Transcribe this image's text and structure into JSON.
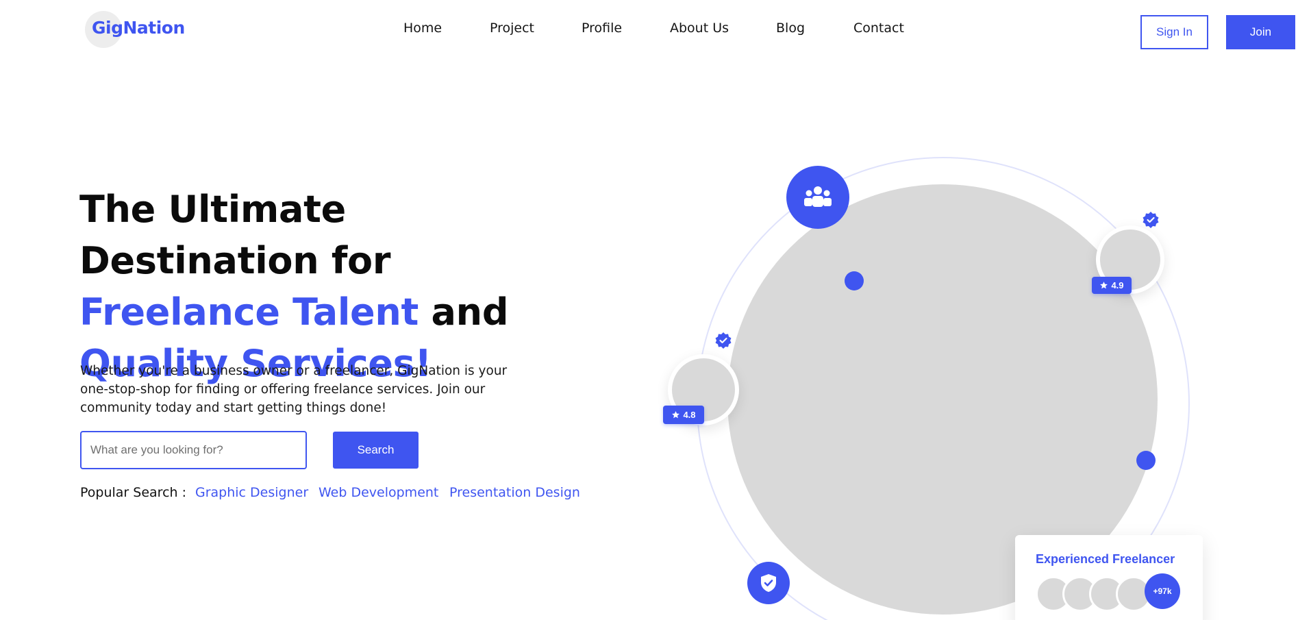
{
  "brand": {
    "logo_text": "GigNation",
    "accent_color": "#3f55f0"
  },
  "nav": {
    "items": [
      {
        "label": "Home"
      },
      {
        "label": "Project"
      },
      {
        "label": "Profile"
      },
      {
        "label": "About Us"
      },
      {
        "label": "Blog"
      },
      {
        "label": "Contact"
      }
    ]
  },
  "auth": {
    "sign_in_label": "Sign In",
    "join_label": "Join"
  },
  "hero": {
    "title_part1": "The Ultimate Destination for ",
    "title_accent1": "Freelance Talent",
    "title_part2": " and ",
    "title_accent2": "Quality Services!",
    "description": "Whether you're a business owner or a freelancer, GigNation is your one-stop-shop for finding or offering freelance services. Join our community today and start getting things done!"
  },
  "search": {
    "placeholder": "What are you looking for?",
    "value": "",
    "button_label": "Search"
  },
  "popular_search": {
    "label": "Popular Search :",
    "links": [
      {
        "label": "Graphic Designer"
      },
      {
        "label": "Web Development"
      },
      {
        "label": "Presentation Design"
      }
    ]
  },
  "illustration": {
    "ratings": [
      {
        "value": "4.9"
      },
      {
        "value": "4.8"
      }
    ],
    "icons": [
      "users-group-icon",
      "shield-check-icon",
      "verified-badge-icon",
      "star-icon"
    ],
    "card": {
      "title": "Experienced Freelancer",
      "count": "+97k"
    }
  }
}
